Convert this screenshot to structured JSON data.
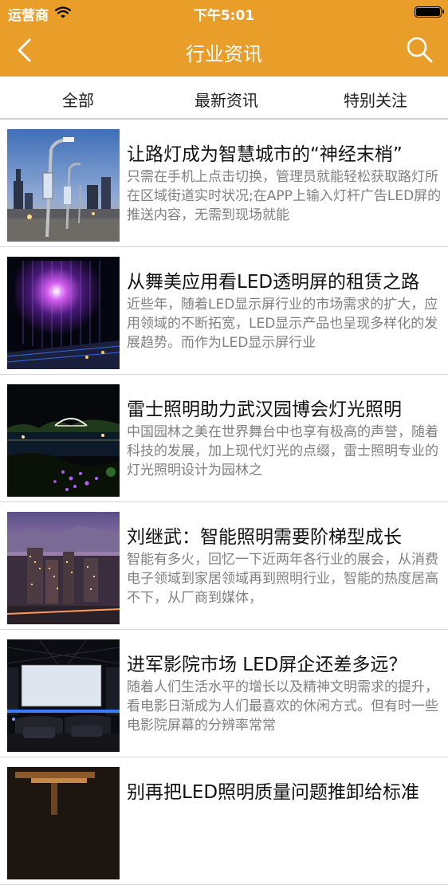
{
  "status_bar": {
    "carrier": "运营商",
    "time": "下午5:01"
  },
  "nav": {
    "title": "行业资讯"
  },
  "tabs": [
    {
      "label": "全部"
    },
    {
      "label": "最新资讯"
    },
    {
      "label": "特别关注"
    }
  ],
  "articles": [
    {
      "title": "让路灯成为智慧城市的“神经末梢”",
      "summary": "只需在手机上点击切换，管理员就能轻松获取路灯所在区域街道实时状况;在APP上输入灯杆广告LED屏的推送内容，无需到现场就能"
    },
    {
      "title": "从舞美应用看LED透明屏的租赁之路",
      "summary": "近些年，随着LED显示屏行业的市场需求的扩大，应用领域的不断拓宽，LED显示产品也呈现多样化的发展趋势。而作为LED显示屏行业"
    },
    {
      "title": "雷士照明助力武汉园博会灯光照明",
      "summary": "中国园林之美在世界舞台中也享有极高的声誉，随着科技的发展，加上现代灯光的点缀，雷士照明专业的灯光照明设计为园林之"
    },
    {
      "title": "刘继武：智能照明需要阶梯型成长",
      "summary": "智能有多火，回忆一下近两年各行业的展会，从消费电子领域到家居领域再到照明行业，智能的热度居高不下，从厂商到媒体，"
    },
    {
      "title": "进军影院市场 LED屏企还差多远？",
      "summary": "随着人们生活水平的增长以及精神文明需求的提升，看电影日渐成为人们最喜欢的休闲方式。但有时一些电影院屏幕的分辨率常常"
    },
    {
      "title": "别再把LED照明质量问题推卸给标准",
      "summary": ""
    }
  ]
}
